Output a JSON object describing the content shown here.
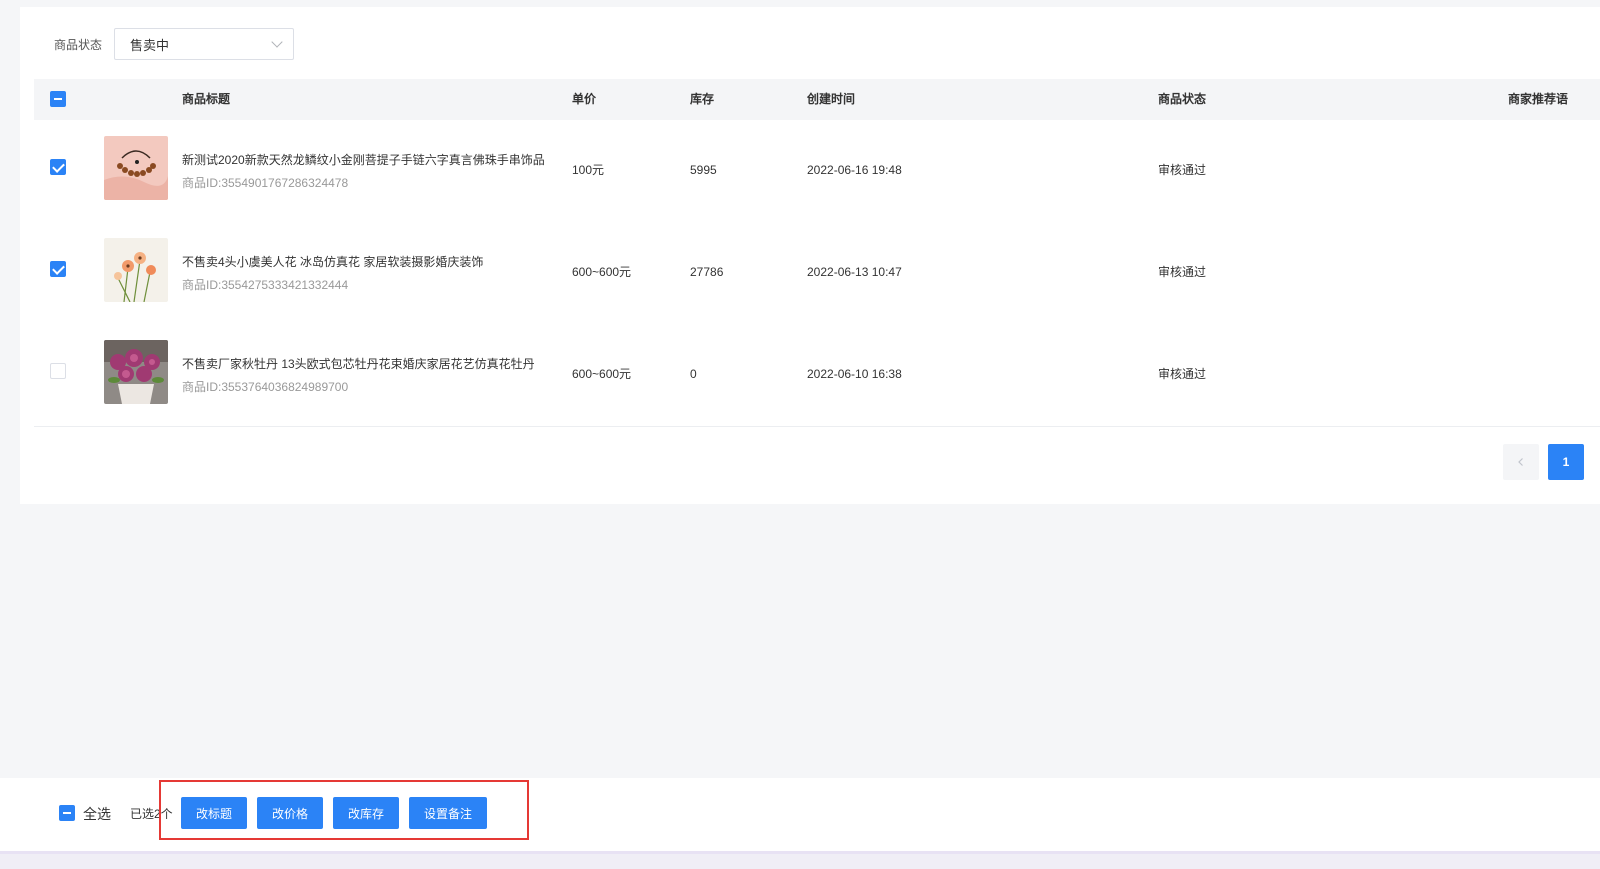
{
  "filter": {
    "label": "商品状态",
    "value": "售卖中"
  },
  "table": {
    "columns": {
      "title": "商品标题",
      "price": "单价",
      "stock": "库存",
      "created": "创建时间",
      "status": "商品状态",
      "recommend": "商家推荐语"
    },
    "rows": [
      {
        "checked": true,
        "title": "新测试2020新款天然龙鳞纹小金刚菩提子手链六字真言佛珠手串饰品",
        "id": "商品ID:3554901767286324478",
        "price": "100元",
        "stock": "5995",
        "created": "2022-06-16 19:48",
        "status": "审核通过",
        "thumb": "bracelet"
      },
      {
        "checked": true,
        "title": "不售卖4头小虞美人花 冰岛仿真花 家居软装摄影婚庆装饰",
        "id": "商品ID:3554275333421332444",
        "price": "600~600元",
        "stock": "27786",
        "created": "2022-06-13 10:47",
        "status": "审核通过",
        "thumb": "poppy"
      },
      {
        "checked": false,
        "title": "不售卖厂家秋牡丹 13头欧式包芯牡丹花束婚庆家居花艺仿真花牡丹",
        "id": "商品ID:3553764036824989700",
        "price": "600~600元",
        "stock": "0",
        "created": "2022-06-10 16:38",
        "status": "审核通过",
        "thumb": "peony"
      }
    ]
  },
  "pagination": {
    "prev_icon": "chevron-left-icon",
    "current": "1"
  },
  "footer": {
    "select_all": "全选",
    "selected_text": "已选2个",
    "buttons": {
      "edit_title": "改标题",
      "edit_price": "改价格",
      "edit_stock": "改库存",
      "set_note": "设置备注"
    }
  },
  "colors": {
    "primary": "#2b83f6",
    "highlight_box": "#e53935"
  }
}
